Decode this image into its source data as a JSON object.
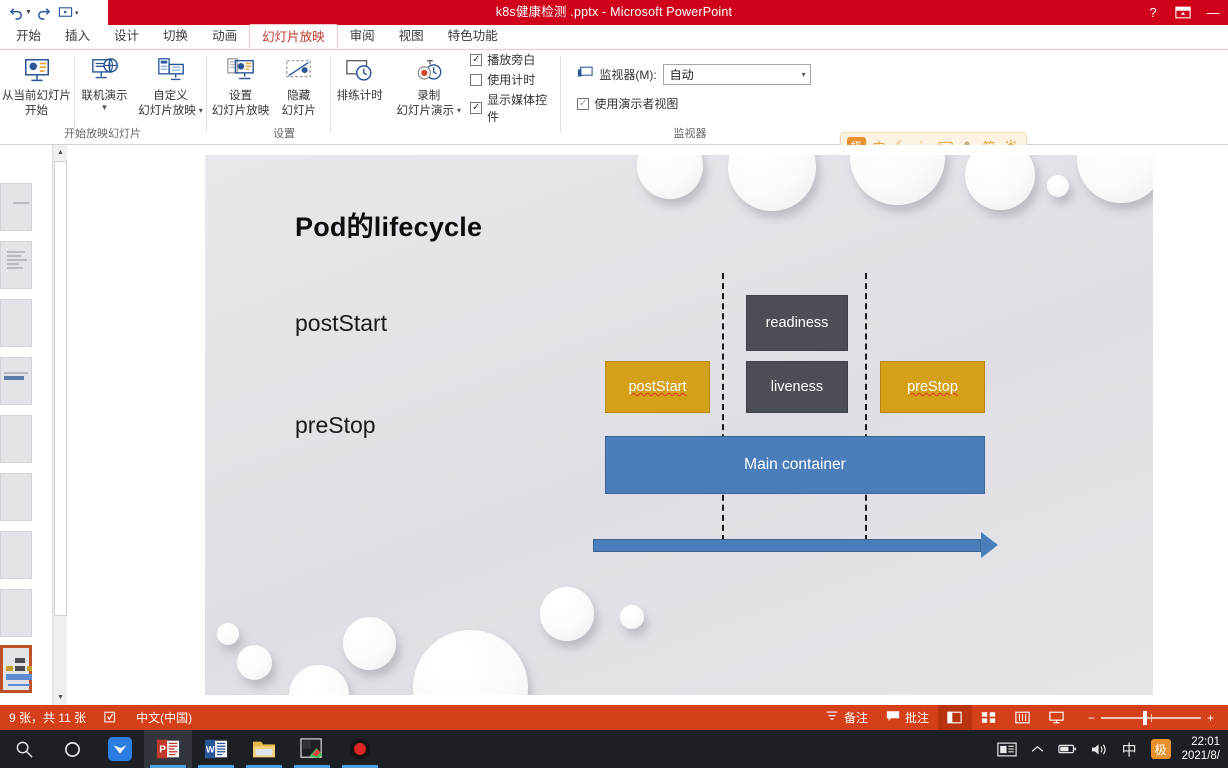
{
  "window": {
    "title": "k8s健康检测 .pptx -  Microsoft PowerPoint",
    "qat": [
      {
        "name": "undo",
        "glyph": "↺"
      },
      {
        "name": "redo",
        "glyph": "↻"
      },
      {
        "name": "start-slideshow",
        "glyph": "▭"
      },
      {
        "name": "customize-qat",
        "glyph": "▾"
      }
    ],
    "controls": [
      {
        "name": "help",
        "glyph": "?"
      },
      {
        "name": "ribbon-display-options",
        "glyph": "⊡"
      },
      {
        "name": "minimize",
        "glyph": "—"
      }
    ]
  },
  "tabs": [
    {
      "label": "开始",
      "active": false
    },
    {
      "label": "插入",
      "active": false
    },
    {
      "label": "设计",
      "active": false
    },
    {
      "label": "切换",
      "active": false
    },
    {
      "label": "动画",
      "active": false
    },
    {
      "label": "幻灯片放映",
      "active": true
    },
    {
      "label": "审阅",
      "active": false
    },
    {
      "label": "视图",
      "active": false
    },
    {
      "label": "特色功能",
      "active": false
    }
  ],
  "ribbon": {
    "groups": [
      {
        "name": "start-slideshow",
        "label": "开始放映幻灯片"
      },
      {
        "name": "setup",
        "label": "设置"
      },
      {
        "name": "monitors",
        "label": "监视器"
      }
    ],
    "buttons": {
      "from_current": "从当前幻灯片\n开始",
      "from_current_l1": "从当前幻灯片",
      "from_current_l2": "开始",
      "present_online": "联机演示",
      "custom_show_l1": "自定义",
      "custom_show_l2": "幻灯片放映",
      "setup_show_l1": "设置",
      "setup_show_l2": "幻灯片放映",
      "hide_slide_l1": "隐藏",
      "hide_slide_l2": "幻灯片",
      "rehearse": "排练计时",
      "record_l1": "录制",
      "record_l2": "幻灯片演示"
    },
    "checkboxes": [
      {
        "label": "播放旁白",
        "checked": true
      },
      {
        "label": "使用计时",
        "checked": false
      },
      {
        "label": "显示媒体控件",
        "checked": true
      }
    ],
    "monitor": {
      "label": "监视器(M):",
      "value": "自动",
      "presenter_view_label": "使用演示者视图",
      "presenter_view_checked": true
    }
  },
  "ime_bar": {
    "logo": "极",
    "items": [
      "中",
      "☾",
      "ʾ,",
      "⌨",
      "👤",
      "简",
      "⚙"
    ]
  },
  "slide": {
    "title": "Pod的lifecycle",
    "side_labels": [
      {
        "text": "postStart"
      },
      {
        "text": "preStop"
      }
    ],
    "boxes": [
      {
        "name": "readiness",
        "text": "readiness",
        "style": "dark"
      },
      {
        "name": "postStart",
        "text": "postStart",
        "style": "gold",
        "spellcheck": true
      },
      {
        "name": "liveness",
        "text": "liveness",
        "style": "dark"
      },
      {
        "name": "preStop",
        "text": "preStop",
        "style": "gold",
        "spellcheck": true
      },
      {
        "name": "main-container",
        "text": "Main container",
        "style": "blue"
      }
    ],
    "colors": {
      "dark_box": "#4b4e54",
      "gold_box": "#d4a017",
      "blue_box": "#4a7ebb",
      "background": "#e4e4e9"
    }
  },
  "thumbnails": {
    "count": 9,
    "selected_index": 8
  },
  "statusbar": {
    "slide_count": "9 张，共 11 张",
    "language": "中文(中国)",
    "notes": "备注",
    "comments": "批注",
    "views": [
      {
        "name": "normal-view",
        "glyph": "▤",
        "active": true
      },
      {
        "name": "slide-sorter-view",
        "glyph": "▦",
        "active": false
      },
      {
        "name": "reading-view",
        "glyph": "▥",
        "active": false
      },
      {
        "name": "slideshow-view",
        "glyph": "▭",
        "active": false
      }
    ],
    "zoom_minus": "−",
    "zoom_plus": "+"
  },
  "taskbar": {
    "icons": [
      {
        "name": "search",
        "glyph": "⌕"
      },
      {
        "name": "cortana",
        "glyph": "○"
      },
      {
        "name": "foxmail",
        "glyph": "✦"
      },
      {
        "name": "powerpoint",
        "glyph": "P"
      },
      {
        "name": "word",
        "glyph": "W"
      },
      {
        "name": "file-explorer",
        "glyph": "▰"
      },
      {
        "name": "snipaste",
        "glyph": "✂"
      },
      {
        "name": "recorder",
        "glyph": "●"
      }
    ],
    "tray": [
      {
        "name": "news-and-interests",
        "glyph": "▤"
      },
      {
        "name": "show-hidden-icons",
        "glyph": "︿"
      },
      {
        "name": "battery",
        "glyph": "▭"
      },
      {
        "name": "volume",
        "glyph": "◀))"
      },
      {
        "name": "ime-chinese",
        "glyph": "中"
      },
      {
        "name": "ime-logo",
        "glyph": "极"
      }
    ],
    "clock_time": "22:01",
    "clock_date": "2021/8/"
  }
}
